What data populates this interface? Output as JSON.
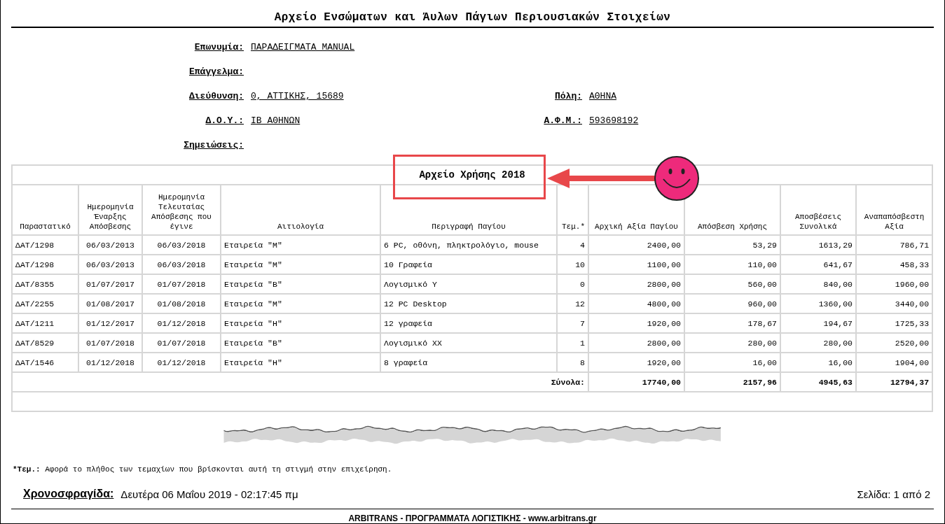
{
  "report_title": "Αρχείο Ενσώματων και Άυλων Πάγιων Περιουσιακών Στοιχείων",
  "company_rows": [
    {
      "left": {
        "label": "Επωνυμία:",
        "value": "ΠΑΡΑΔΕΙΓΜΑΤΑ MANUAL"
      }
    },
    {
      "left": {
        "label": "Επάγγελμα:"
      }
    },
    {
      "left": {
        "label": "Διεύθυνση:",
        "value": "0, ΑΤΤΙΚΗΣ, 15689"
      },
      "right": {
        "label": "Πόλη:",
        "value": "ΑΘΗΝΑ"
      }
    },
    {
      "left": {
        "label": "Δ.Ο.Υ.:",
        "value": "ΙΒ ΑΘΗΝΩΝ"
      },
      "right": {
        "label": "Α.Φ.Μ.:",
        "value": "593698192"
      }
    },
    {
      "left": {
        "label": "Σημειώσεις:"
      }
    }
  ],
  "table": {
    "section_title": "Αρχείο Χρήσης 2018",
    "columns": [
      {
        "label": "Παραστατικό",
        "kind": "text"
      },
      {
        "label": "Ημερομηνία Έναρξης Απόσβεσης",
        "kind": "date"
      },
      {
        "label": "Ημερομηνία Τελευταίας Απόσβεσης που έγινε",
        "kind": "date"
      },
      {
        "label": "Αιτιολογία",
        "kind": "text"
      },
      {
        "label": "Περιγραφή Παγίου",
        "kind": "text"
      },
      {
        "label": "Τεμ.*",
        "kind": "number"
      },
      {
        "label": "Αρχική Αξία Παγίου",
        "kind": "number"
      },
      {
        "label": "Απόσβεση Χρήσης",
        "kind": "number"
      },
      {
        "label": "Αποσβέσεις Συνολικά",
        "kind": "number"
      },
      {
        "label": "Αναπαπόσβεστη Αξία",
        "kind": "number"
      }
    ],
    "rows": [
      [
        "ΔΑΤ/1298",
        "06/03/2013",
        "06/03/2018",
        "Εταιρεία \"Μ\"",
        "6 PC, οθόνη, πληκτρολόγιο, mouse",
        "4",
        "2400,00",
        "53,29",
        "1613,29",
        "786,71"
      ],
      [
        "ΔΑΤ/1298",
        "06/03/2013",
        "06/03/2018",
        "Εταιρεία \"Μ\"",
        "10 Γραφεία",
        "10",
        "1100,00",
        "110,00",
        "641,67",
        "458,33"
      ],
      [
        "ΔΑΤ/8355",
        "01/07/2017",
        "01/07/2018",
        "Εταιρεία \"Β\"",
        "Λογισμικό Υ",
        "0",
        "2800,00",
        "560,00",
        "840,00",
        "1960,00"
      ],
      [
        "ΔΑΤ/2255",
        "01/08/2017",
        "01/08/2018",
        "Εταιρεία \"Μ\"",
        "12 PC Desktop",
        "12",
        "4800,00",
        "960,00",
        "1360,00",
        "3440,00"
      ],
      [
        "ΔΑΤ/1211",
        "01/12/2017",
        "01/12/2018",
        "Εταιρεία \"Η\"",
        "12 γραφεία",
        "7",
        "1920,00",
        "178,67",
        "194,67",
        "1725,33"
      ],
      [
        "ΔΑΤ/8529",
        "01/07/2018",
        "01/07/2018",
        "Εταιρεία \"Β\"",
        "Λογισμικό ΧΧ",
        "1",
        "2800,00",
        "280,00",
        "280,00",
        "2520,00"
      ],
      [
        "ΔΑΤ/1546",
        "01/12/2018",
        "01/12/2018",
        "Εταιρεία \"Η\"",
        "8 γραφεία",
        "8",
        "1920,00",
        "16,00",
        "16,00",
        "1904,00"
      ]
    ],
    "totals": {
      "label": "Σύνολα:",
      "values": [
        "17740,00",
        "2157,96",
        "4945,63",
        "12794,37"
      ]
    }
  },
  "footnote": {
    "term": "*Τεμ.:",
    "text": "Αφορά το πλήθος των τεμαχίων που βρίσκονται αυτή τη στιγμή στην επιχείρηση."
  },
  "timestamp": {
    "label": "Χρονοσφραγίδα:",
    "value": "Δευτέρα 06 Μαΐου 2019 - 02:17:45 πμ"
  },
  "page_info": "Σελίδα: 1 από 2",
  "footer": "ARBITRANS - ΠΡΟΓΡΑΜΜΑΤΑ ΛΟΓΙΣΤΙΚΗΣ -  www.arbitrans.gr"
}
